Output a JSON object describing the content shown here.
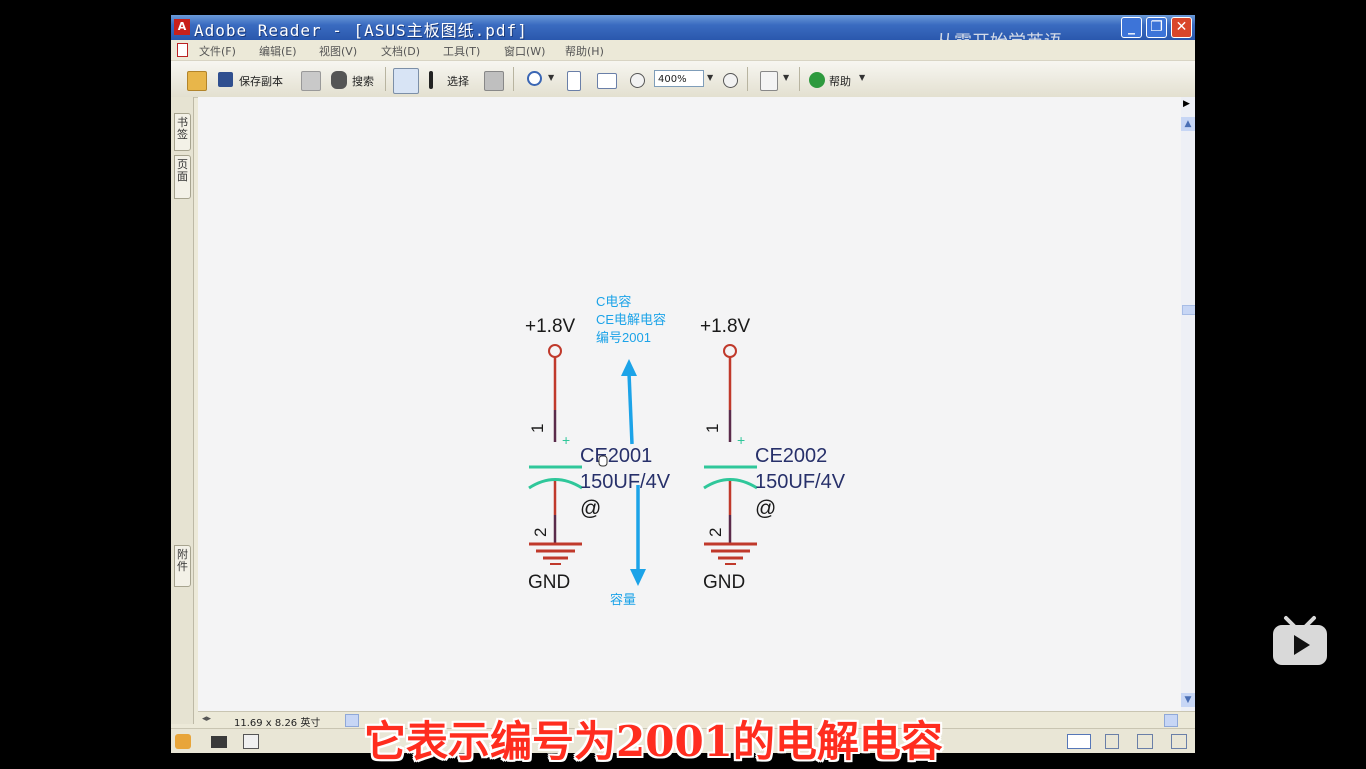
{
  "window": {
    "title": "Adobe Reader - [ASUS主板图纸.pdf]",
    "icon_glyph": "A",
    "minimize_glyph": "_",
    "maximize_glyph": "❐",
    "close_glyph": "✕"
  },
  "watermark": "从零开始学英语",
  "menu": [
    "文件(F)",
    "编辑(E)",
    "视图(V)",
    "文档(D)",
    "工具(T)",
    "窗口(W)",
    "帮助(H)"
  ],
  "toolbar": {
    "save_copy": "保存副本",
    "search": "搜索",
    "select": "选择",
    "zoom_value": "400%",
    "help": "帮助"
  },
  "left_nav": {
    "tab_bookmarks": "书签",
    "tab_pages": "页面",
    "tab_attachments": "附件"
  },
  "schematic": {
    "parts": [
      {
        "power": "+1.8V",
        "ref": "CE2001",
        "value": "150UF/4V",
        "attr": "@",
        "pin1": "1",
        "pin2": "2",
        "ground": "GND",
        "plus": "+"
      },
      {
        "power": "+1.8V",
        "ref": "CE2002",
        "value": "150UF/4V",
        "attr": "@",
        "pin1": "1",
        "pin2": "2",
        "ground": "GND",
        "plus": "+"
      }
    ],
    "annotation_top": [
      "C电容",
      "CE电解电容",
      "编号2001"
    ],
    "annotation_bottom": "容量",
    "colors": {
      "wire": "#c0392b",
      "pin_line": "#5a2a4a",
      "cap": "#2fc79a",
      "text": "#27306a",
      "annotation": "#1ca3e8"
    }
  },
  "status": {
    "page_size": "11.69 x 8.26 英寸"
  },
  "subtitle": "它表示编号为2001的电解电容"
}
